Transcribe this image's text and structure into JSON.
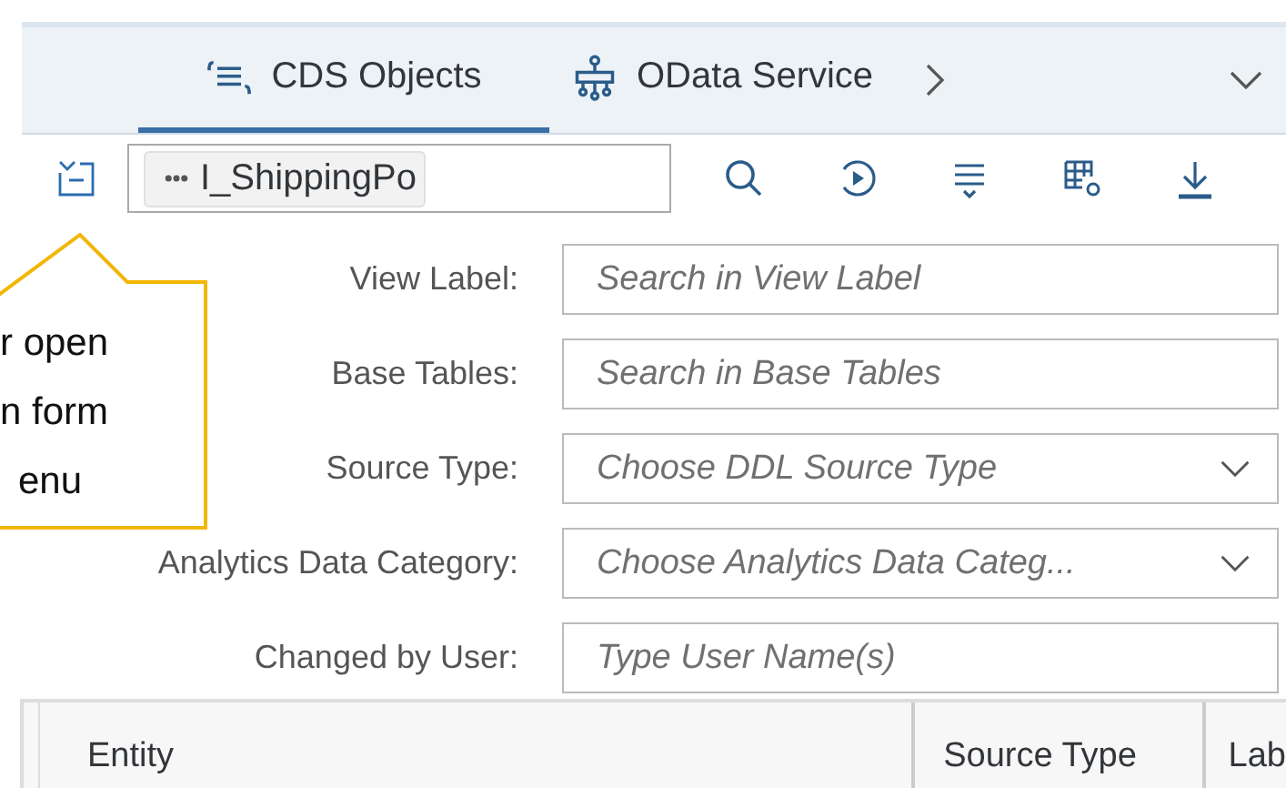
{
  "tabs": [
    {
      "label": "CDS Objects",
      "kind": "cds",
      "selected": true
    },
    {
      "label": "OData Service",
      "kind": "odata",
      "selected": false
    }
  ],
  "search": {
    "token": "I_ShippingPo"
  },
  "callout": {
    "lines": [
      "r open",
      "n form",
      "enu"
    ]
  },
  "filters": [
    {
      "label": "View Label:",
      "placeholder": "Search in View Label",
      "kind": "input"
    },
    {
      "label": "Base Tables:",
      "placeholder": "Search in Base Tables",
      "kind": "input"
    },
    {
      "label": "Source Type:",
      "placeholder": "Choose DDL Source Type",
      "kind": "select"
    },
    {
      "label": "Analytics Data Category:",
      "placeholder": "Choose Analytics Data Categ...",
      "kind": "select"
    },
    {
      "label": "Changed by User:",
      "placeholder": "Type User Name(s)",
      "kind": "input"
    }
  ],
  "table": {
    "columns": [
      "Entity",
      "Source Type",
      "Lab"
    ]
  }
}
